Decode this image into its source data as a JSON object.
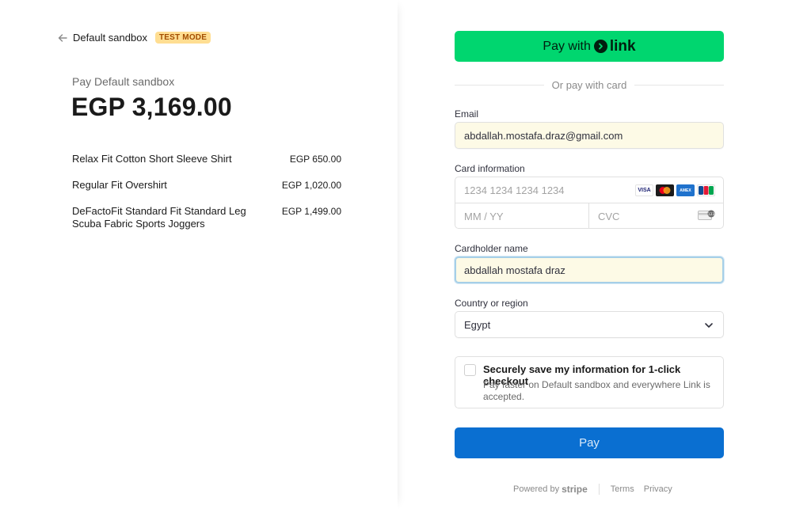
{
  "header": {
    "merchant_name": "Default sandbox",
    "test_badge": "TEST MODE"
  },
  "summary": {
    "pay_label": "Pay Default sandbox",
    "total": "EGP 3,169.00",
    "items": [
      {
        "name": "Relax Fit Cotton Short Sleeve Shirt",
        "price": "EGP 650.00"
      },
      {
        "name": "Regular Fit Overshirt",
        "price": "EGP 1,020.00"
      },
      {
        "name": "DeFactoFit Standard Fit Standard Leg Scuba Fabric Sports Joggers",
        "price": "EGP 1,499.00"
      }
    ]
  },
  "payment": {
    "link_button_prefix": "Pay with",
    "link_word": "link",
    "divider_text": "Or pay with card",
    "email_label": "Email",
    "email_value": "abdallah.mostafa.draz@gmail.com",
    "card_label": "Card information",
    "card_number_placeholder": "1234 1234 1234 1234",
    "expiry_placeholder": "MM / YY",
    "cvc_placeholder": "CVC",
    "card_brands": [
      "VISA",
      "MC",
      "AMEX",
      "JCB"
    ],
    "cardholder_label": "Cardholder name",
    "cardholder_value": "abdallah mostafa draz",
    "country_label": "Country or region",
    "country_value": "Egypt",
    "save_title": "Securely save my information for 1-click checkout",
    "save_desc": "Pay faster on Default sandbox and everywhere Link is accepted.",
    "pay_button": "Pay"
  },
  "footer": {
    "powered_by": "Powered by",
    "stripe": "stripe",
    "terms": "Terms",
    "privacy": "Privacy"
  },
  "colors": {
    "link_green": "#00d66f",
    "pay_blue": "#0a6fd1",
    "badge_bg": "#ffde92",
    "badge_text": "#a24d00",
    "autofill_bg": "#fdfae6"
  }
}
